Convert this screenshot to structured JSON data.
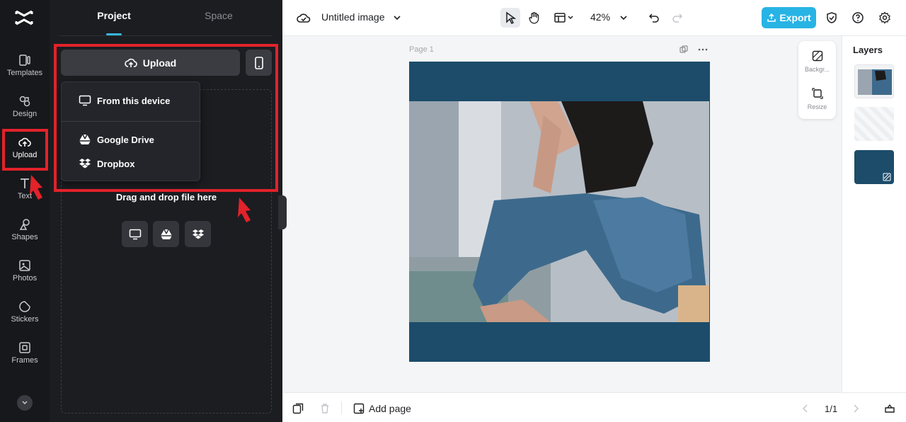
{
  "rail": {
    "items": [
      {
        "label": "Templates",
        "icon": "templates-icon"
      },
      {
        "label": "Design",
        "icon": "design-icon"
      },
      {
        "label": "Upload",
        "icon": "upload-cloud-icon"
      },
      {
        "label": "Text",
        "icon": "text-icon"
      },
      {
        "label": "Shapes",
        "icon": "shapes-icon"
      },
      {
        "label": "Photos",
        "icon": "photos-icon"
      },
      {
        "label": "Stickers",
        "icon": "stickers-icon"
      },
      {
        "label": "Frames",
        "icon": "frames-icon"
      }
    ],
    "active": "Upload"
  },
  "panel": {
    "tabs": [
      {
        "label": "Project"
      },
      {
        "label": "Space"
      }
    ],
    "active_tab": "Project",
    "upload_button": "Upload",
    "drag_text": "Drag and drop file here",
    "menu": {
      "items": [
        {
          "label": "From this device",
          "icon": "monitor-icon"
        },
        {
          "label": "Google Drive",
          "icon": "google-drive-icon"
        },
        {
          "label": "Dropbox",
          "icon": "dropbox-icon"
        }
      ]
    }
  },
  "topbar": {
    "title": "Untitled image",
    "zoom": "42%",
    "export_label": "Export"
  },
  "canvas": {
    "page_label": "Page 1",
    "background_color": "#1c4c6a",
    "side_tools": [
      {
        "label": "Backgr..."
      },
      {
        "label": "Resize"
      }
    ]
  },
  "layers": {
    "title": "Layers"
  },
  "bottombar": {
    "add_page": "Add page",
    "pager": "1/1"
  },
  "colors": {
    "accent": "#27b4e4",
    "annotation": "#e3222a",
    "panel_bg": "#1c1d21"
  }
}
